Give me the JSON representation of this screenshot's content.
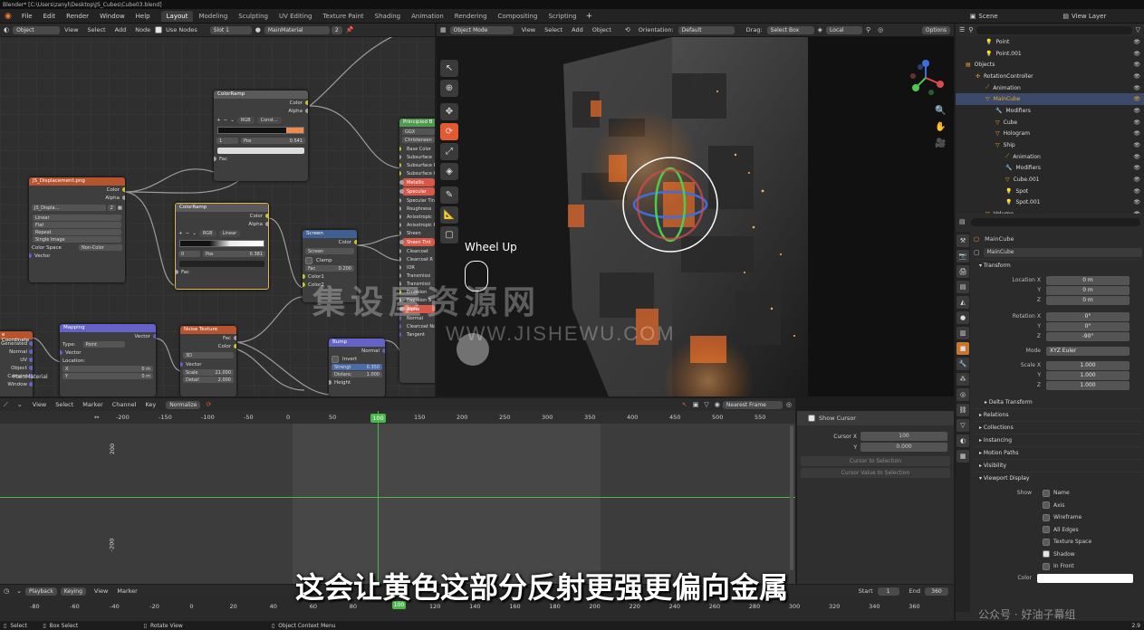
{
  "title_bar": "Blender* [C:\\Users\\zanyl\\Desktop\\JS_Cubes\\Cube03.blend]",
  "menus": [
    "File",
    "Edit",
    "Render",
    "Window",
    "Help"
  ],
  "workspaces": [
    "Layout",
    "Modeling",
    "Sculpting",
    "UV Editing",
    "Texture Paint",
    "Shading",
    "Animation",
    "Rendering",
    "Compositing",
    "Scripting"
  ],
  "active_workspace": "Layout",
  "scene_label": "Scene",
  "view_layer_label": "View Layer",
  "node_header": {
    "object_mode": "Object",
    "items": [
      "View",
      "Select",
      "Add",
      "Node"
    ],
    "use_nodes": "Use Nodes",
    "slot": "Slot 1",
    "material": "MainMaterial",
    "users": "2"
  },
  "nodes": {
    "colorramp1": {
      "title": "ColorRamp",
      "color_mode": "RGB",
      "interp": "Const...",
      "index": "1",
      "pos_label": "Pos",
      "pos": "0.541",
      "out_color": "Color",
      "out_alpha": "Alpha",
      "fac": "Fac"
    },
    "image": {
      "title": "JS_Displacement.png",
      "out_color": "Color",
      "out_alpha": "Alpha",
      "img": "JS_Displa...",
      "users": "2",
      "linear": "Linear",
      "flat": "Flat",
      "repeat": "Repeat",
      "single": "Single Image",
      "cs_label": "Color Space",
      "cs": "Non-Color",
      "vector": "Vector"
    },
    "colorramp2": {
      "title": "ColorRamp",
      "color_mode": "RGB",
      "interp": "Linear",
      "index": "0",
      "pos_label": "Pos",
      "pos": "0.381",
      "out_color": "Color",
      "out_alpha": "Alpha",
      "fac": "Fac"
    },
    "screen": {
      "title": "Screen",
      "out": "Color",
      "mode": "Screen",
      "clamp": "Clamp",
      "fac_label": "Fac",
      "fac": "0.200",
      "c1": "Color1",
      "c2": "Color2"
    },
    "principled": {
      "title": "Principled B",
      "dist": "GGX",
      "ss_method": "Christensen",
      "inputs": [
        "Base Color",
        "Subsurface",
        "Subsurface R",
        "Subsurface Co",
        "Metallic",
        "Specular",
        "Specular Tint",
        "Roughness",
        "Anisotropic",
        "Anisotropic R",
        "Sheen",
        "Sheen Tint",
        "Clearcoat",
        "Clearcoat R",
        "IOR",
        "Transmissi",
        "Transmissi",
        "Emission",
        "Emission S",
        "Alpha",
        "Normal",
        "Clearcoat Nor",
        "Tangent"
      ],
      "highlighted": [
        "Metallic",
        "Specular",
        "Sheen Tint",
        "Alpha"
      ]
    },
    "texcoord": {
      "title": "e Coordinate",
      "outs": [
        "Generated",
        "Normal",
        "UV",
        "Object",
        "Camera",
        "Window"
      ],
      "material": "MainMaterial"
    },
    "mapping": {
      "title": "Mapping",
      "out": "Vector",
      "type_label": "Type:",
      "type": "Point",
      "vector": "Vector",
      "location": "Location:",
      "x_label": "X",
      "x": "0 m",
      "y_label": "Y",
      "y": "0 m"
    },
    "noise": {
      "title": "Noise Texture",
      "out_fac": "Fac",
      "out_color": "Color",
      "dim": "3D",
      "vector": "Vector",
      "scale_label": "Scale",
      "scale": "21.000",
      "detail_label": "Detail",
      "detail": "2.000"
    },
    "bump": {
      "title": "Bump",
      "out": "Normal",
      "invert": "Invert",
      "strength_label": "Strengt",
      "strength": "0.350",
      "distance_label": "Distanc",
      "distance": "1.000",
      "height": "Height"
    }
  },
  "viewport_header": {
    "mode": "Object Mode",
    "items": [
      "View",
      "Select",
      "Add",
      "Object"
    ],
    "orientation_label": "Orientation:",
    "orientation": "Default",
    "drag_label": "Drag:",
    "drag": "Select Box",
    "pivot": "Local",
    "options": "Options"
  },
  "viewport_overlay_text": "Wheel Up",
  "outliner": {
    "items": [
      {
        "label": "Point",
        "indent": 3
      },
      {
        "label": "Point.001",
        "indent": 3
      },
      {
        "label": "Objects",
        "indent": 1
      },
      {
        "label": "RotationController",
        "indent": 2
      },
      {
        "label": "Animation",
        "indent": 3
      },
      {
        "label": "MainCube",
        "indent": 3,
        "selected": true
      },
      {
        "label": "Modifiers",
        "indent": 4
      },
      {
        "label": "Cube",
        "indent": 4
      },
      {
        "label": "Hologram",
        "indent": 4
      },
      {
        "label": "Ship",
        "indent": 4
      },
      {
        "label": "Animation",
        "indent": 5
      },
      {
        "label": "Modifiers",
        "indent": 5
      },
      {
        "label": "Cube.001",
        "indent": 5
      },
      {
        "label": "Spot",
        "indent": 5
      },
      {
        "label": "Spot.001",
        "indent": 5
      },
      {
        "label": "Volume",
        "indent": 3
      }
    ]
  },
  "properties": {
    "object_name_top": "MainCube",
    "object_name": "MainCube",
    "transform_label": "Transform",
    "location": {
      "label": "Location X",
      "x": "0 m",
      "y_label": "Y",
      "y": "0 m",
      "z_label": "Z",
      "z": "0 m"
    },
    "rotation": {
      "label": "Rotation X",
      "x": "0°",
      "y_label": "Y",
      "y": "0°",
      "z_label": "Z",
      "z": "-90°"
    },
    "mode_label": "Mode",
    "mode": "XYZ Euler",
    "scale": {
      "label": "Scale X",
      "x": "1.000",
      "y_label": "Y",
      "y": "1.000",
      "z_label": "Z",
      "z": "1.000"
    },
    "delta": "Delta Transform",
    "sections": [
      "Relations",
      "Collections",
      "Instancing",
      "Motion Paths",
      "Visibility"
    ],
    "viewport_display": "Viewport Display",
    "show_label": "Show",
    "show_options": [
      {
        "label": "Name",
        "checked": false
      },
      {
        "label": "Axis",
        "checked": false
      },
      {
        "label": "Wireframe",
        "checked": false
      },
      {
        "label": "All Edges",
        "checked": false
      },
      {
        "label": "Texture Space",
        "checked": false
      },
      {
        "label": "Shadow",
        "checked": true
      },
      {
        "label": "In Front",
        "checked": false
      }
    ],
    "color_label": "Color"
  },
  "graph_editor": {
    "items": [
      "View",
      "Select",
      "Marker",
      "Channel",
      "Key"
    ],
    "normalize": "Normalize",
    "interp": "Nearest Frame",
    "ruler": [
      "-200",
      "-150",
      "-100",
      "-50",
      "0",
      "50",
      "100",
      "150",
      "200",
      "250",
      "300",
      "350",
      "400",
      "450",
      "500",
      "550"
    ],
    "current_frame": "100",
    "y_labels": [
      "200",
      "-200"
    ],
    "show_cursor": "Show Cursor",
    "cursor_x_label": "Cursor X",
    "cursor_x": "100",
    "cursor_y_label": "Y",
    "cursor_y": "0.000",
    "btn1": "Cursor to Selection",
    "btn2": "Cursor Value to Selection"
  },
  "timeline": {
    "items": [
      "Playback",
      "Keying",
      "View",
      "Marker"
    ],
    "ruler": [
      "-80",
      "-60",
      "-40",
      "-20",
      "0",
      "20",
      "40",
      "60",
      "80",
      "100",
      "120",
      "140",
      "160",
      "180",
      "200",
      "220",
      "240",
      "260",
      "280",
      "300",
      "320",
      "340",
      "360"
    ],
    "current": "100",
    "start_label": "Start",
    "start": "1",
    "end_label": "End",
    "end": "360"
  },
  "status": {
    "select": "Select",
    "box_select": "Box Select",
    "rotate": "Rotate View",
    "context": "Object Context Menu",
    "version": "2.9"
  },
  "subtitle": "这会让黄色这部分反射更强更偏向金属",
  "watermark_cn": "集设屋资源网",
  "watermark_en": "WWW.JISHEWU.COM",
  "corner_watermark": "公众号 · 好油子幕组"
}
